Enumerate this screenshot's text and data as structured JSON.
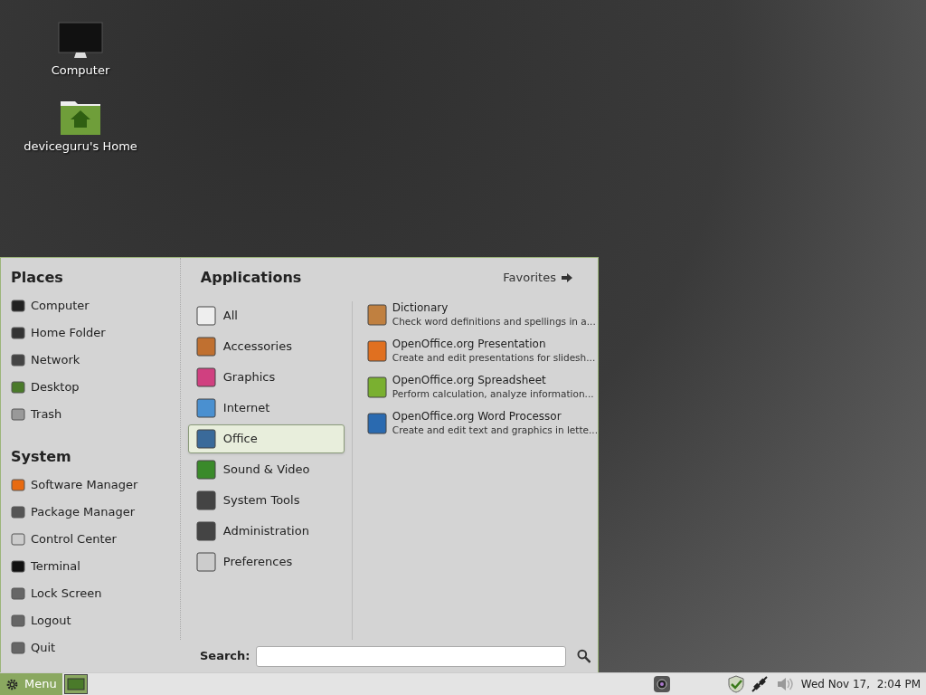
{
  "desktop_icons": [
    {
      "label": "Computer",
      "kind": "computer"
    },
    {
      "label": "deviceguru's Home",
      "kind": "home"
    }
  ],
  "menu": {
    "places": {
      "title": "Places",
      "items": [
        "Computer",
        "Home Folder",
        "Network",
        "Desktop",
        "Trash"
      ]
    },
    "system": {
      "title": "System",
      "items": [
        "Software Manager",
        "Package Manager",
        "Control Center",
        "Terminal",
        "Lock Screen",
        "Logout",
        "Quit"
      ]
    },
    "applications": {
      "title": "Applications",
      "favorites": "Favorites",
      "categories": [
        {
          "label": "All",
          "selected": false
        },
        {
          "label": "Accessories",
          "selected": false
        },
        {
          "label": "Graphics",
          "selected": false
        },
        {
          "label": "Internet",
          "selected": false
        },
        {
          "label": "Office",
          "selected": true
        },
        {
          "label": "Sound & Video",
          "selected": false
        },
        {
          "label": "System Tools",
          "selected": false
        },
        {
          "label": "Administration",
          "selected": false
        },
        {
          "label": "Preferences",
          "selected": false
        }
      ],
      "apps": [
        {
          "name": "Dictionary",
          "description": "Check word definitions and spellings in a..."
        },
        {
          "name": "OpenOffice.org Presentation",
          "description": "Create and edit presentations for slidesh..."
        },
        {
          "name": "OpenOffice.org Spreadsheet",
          "description": "Perform calculation, analyze information..."
        },
        {
          "name": "OpenOffice.org Word Processor",
          "description": "Create and edit text and graphics in lette..."
        }
      ]
    },
    "search": {
      "label": "Search:"
    }
  },
  "taskbar": {
    "menu_button": "Menu",
    "clock": "Wed Nov 17,  2:04 PM"
  }
}
